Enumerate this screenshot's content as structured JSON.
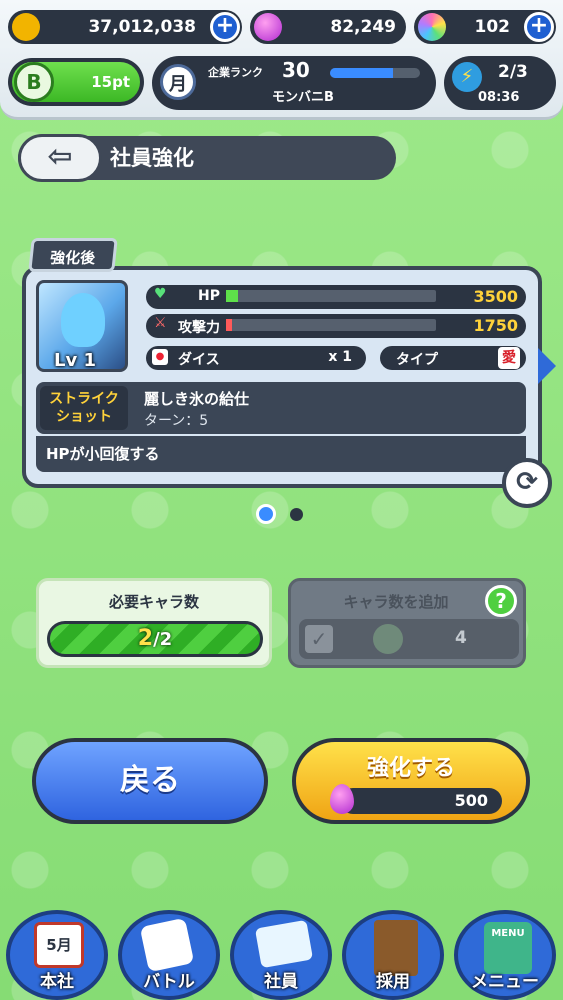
{
  "topbar": {
    "coins": "37,012,038",
    "magic": "82,249",
    "gems": "102",
    "bonus_pt": "15pt",
    "rank_label": "企業ランク",
    "rank_value": "30",
    "company_name": "モンバニB",
    "stamina": "2/3",
    "timer": "08:36",
    "month_icon_text": "月",
    "b_badge": "B",
    "rank_progress": 0.7
  },
  "header": {
    "title": "社員強化"
  },
  "card": {
    "tag": "強化後",
    "level": "Lv 1",
    "hp_label": "HP",
    "hp_value": "3500",
    "atk_label": "攻撃力",
    "atk_value": "1750",
    "dice_label": "ダイス",
    "dice_value": "x 1",
    "type_label": "タイプ",
    "type_value": "愛",
    "strike_label_1": "ストライク",
    "strike_label_2": "ショット",
    "skill_name": "麗しき氷の給仕",
    "turn_text": "ターン：5",
    "skill_desc": "HPが小回復する"
  },
  "pager": {
    "current": 1,
    "total": 2
  },
  "required": {
    "title": "必要キャラ数",
    "current": "2",
    "total": "/2"
  },
  "add": {
    "title": "キャラ数を追加",
    "count": "4",
    "help": "?"
  },
  "buttons": {
    "back": "戻る",
    "enhance": "強化する",
    "cost": "500"
  },
  "nav": {
    "items": [
      {
        "label": "本社",
        "badge": "5月"
      },
      {
        "label": "バトル"
      },
      {
        "label": "社員"
      },
      {
        "label": "採用"
      },
      {
        "label": "メニュー",
        "badge": "MENU"
      }
    ]
  }
}
